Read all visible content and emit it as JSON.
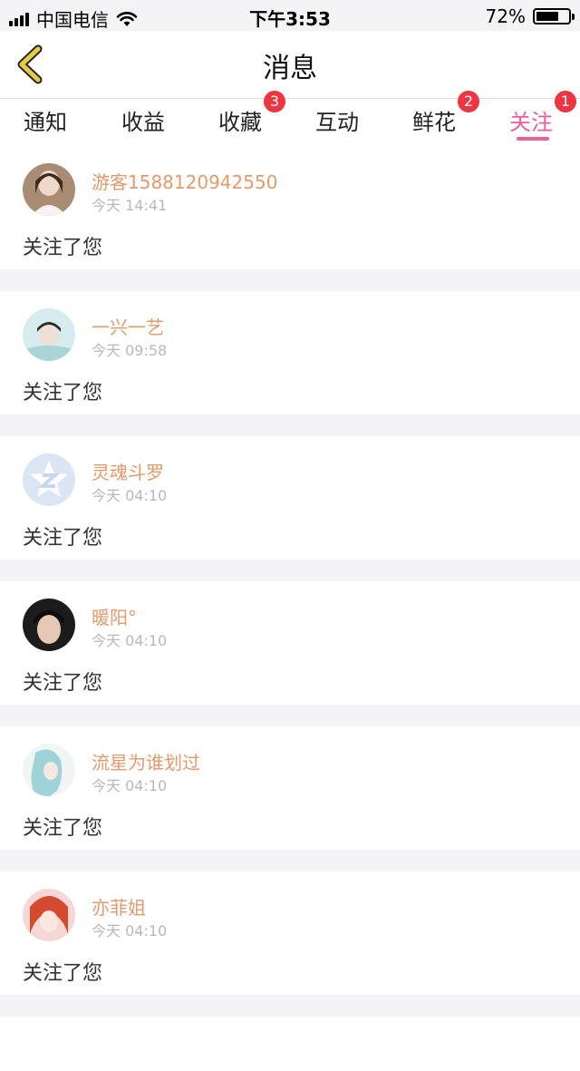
{
  "status_bar": {
    "carrier": "中国电信",
    "time": "下午3:53",
    "battery": "72%",
    "battery_level": 0.72
  },
  "nav": {
    "title": "消息",
    "back_icon": "chevron-left-icon",
    "back_color": "#e9c94a"
  },
  "tabs": [
    {
      "label": "通知"
    },
    {
      "label": "收益"
    },
    {
      "label": "收藏",
      "badge": "3"
    },
    {
      "label": "互动"
    },
    {
      "label": "鲜花",
      "badge": "2"
    },
    {
      "label": "关注",
      "badge": "1",
      "active": true
    }
  ],
  "colors": {
    "accent": "#ee5e98",
    "badge": "#ee3540",
    "username": "#e59a6b",
    "timestamp": "#b8b8b8"
  },
  "feed": [
    {
      "name": "游客1588120942550",
      "time": "今天 14:41",
      "action": "关注了您"
    },
    {
      "name": "一兴一艺",
      "time": "今天 09:58",
      "action": "关注了您"
    },
    {
      "name": "灵魂斗罗",
      "time": "今天 04:10",
      "action": "关注了您"
    },
    {
      "name": "暖阳°",
      "time": "今天 04:10",
      "action": "关注了您"
    },
    {
      "name": "流星为谁划过",
      "time": "今天 04:10",
      "action": "关注了您"
    },
    {
      "name": "亦菲姐",
      "time": "今天 04:10",
      "action": "关注了您"
    }
  ]
}
